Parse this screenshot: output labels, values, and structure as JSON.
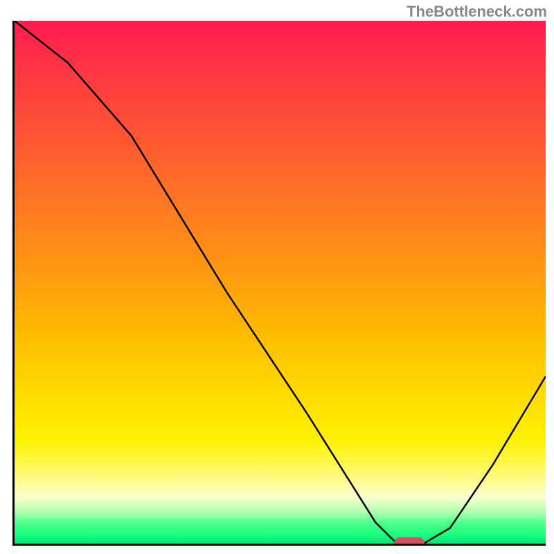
{
  "watermark": "TheBottleneck.com",
  "chart_data": {
    "type": "line",
    "title": "",
    "xlabel": "",
    "ylabel": "",
    "xlim": [
      0,
      100
    ],
    "ylim": [
      0,
      100
    ],
    "grid": false,
    "background": {
      "type": "vertical-gradient",
      "stops": [
        {
          "pct": 0,
          "color": "#ff1a4d"
        },
        {
          "pct": 50,
          "color": "#ff9911"
        },
        {
          "pct": 80,
          "color": "#fff000"
        },
        {
          "pct": 100,
          "color": "#00e676"
        }
      ]
    },
    "series": [
      {
        "name": "bottleneck-curve",
        "color": "#000000",
        "x": [
          0,
          10,
          22,
          25,
          40,
          55,
          68,
          72,
          77,
          82,
          90,
          100
        ],
        "values": [
          100,
          92,
          78,
          73,
          48,
          25,
          4,
          0,
          0,
          3,
          15,
          32
        ]
      }
    ],
    "marker": {
      "name": "optimal-point",
      "x": 74,
      "y": 0,
      "color": "#cc5560"
    }
  }
}
